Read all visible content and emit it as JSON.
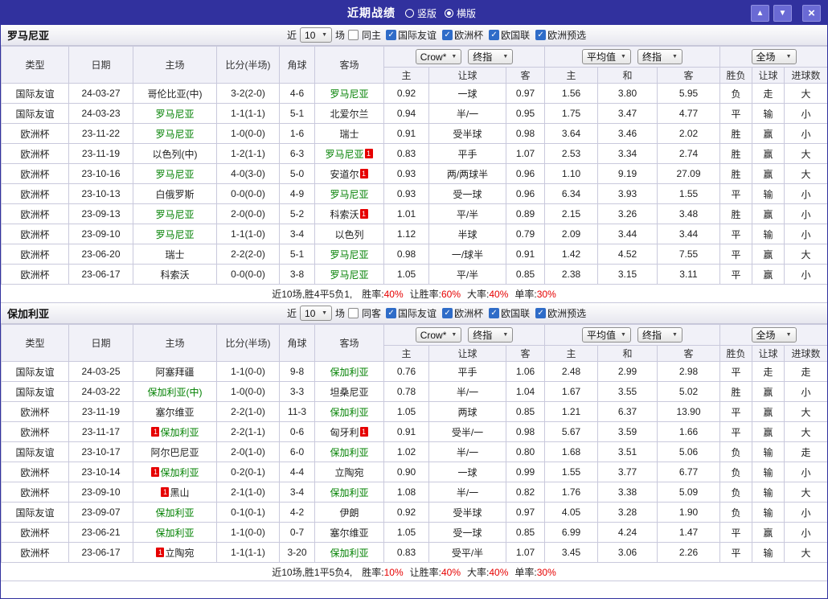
{
  "colors": {
    "titlebar_bg": "#31319e",
    "friendly_badge_bg": "#2f6cc8",
    "euro_badge_bg": "#8b1423",
    "team_highlight": "#008000",
    "win_red": "#e60000",
    "draw_green": "#008000",
    "loss_blue": "#1414cc",
    "score_red": "#a40000"
  },
  "titlebar": {
    "title": "近期战绩",
    "radio_vertical": "竖版",
    "radio_horizontal": "横版"
  },
  "filters": {
    "near_label": "近",
    "count": "10",
    "matches_label": "场",
    "leagues": [
      "国际友谊",
      "欧洲杯",
      "欧国联",
      "欧洲预选"
    ]
  },
  "table_header": {
    "cols": [
      "类型",
      "日期",
      "主场",
      "比分(半场)",
      "角球",
      "客场"
    ],
    "bookmaker": "Crow*",
    "asian_index": "终指",
    "euro_average": "平均值",
    "euro_index": "终指",
    "fulltime": "全场",
    "odds_cols": [
      "主",
      "让球",
      "客"
    ],
    "euro_cols": [
      "主",
      "和",
      "客"
    ],
    "result_cols": [
      "胜负",
      "让球",
      "进球数"
    ]
  },
  "sections": [
    {
      "team": "罗马尼亚",
      "same_label": "同主",
      "rows": [
        [
          "国际友谊",
          "24-03-27",
          "哥伦比亚(中)",
          "3-2(2-0)",
          "4-6",
          {
            "name": "罗马尼亚",
            "hl": true
          },
          "0.92",
          "一球",
          "0.97",
          "1.56",
          "3.80",
          "5.95",
          "负",
          "走",
          "大"
        ],
        [
          "国际友谊",
          "24-03-23",
          {
            "name": "罗马尼亚",
            "hl": true
          },
          "1-1(1-1)",
          "5-1",
          "北爱尔兰",
          "0.94",
          "半/一",
          "0.95",
          "1.75",
          "3.47",
          "4.77",
          "平",
          "输",
          "小"
        ],
        [
          "欧洲杯",
          "23-11-22",
          {
            "name": "罗马尼亚",
            "hl": true
          },
          "1-0(0-0)",
          "1-6",
          "瑞士",
          "0.91",
          "受半球",
          "0.98",
          "3.64",
          "3.46",
          "2.02",
          "胜",
          "赢",
          "小"
        ],
        [
          "欧洲杯",
          "23-11-19",
          "以色列(中)",
          "1-2(1-1)",
          "6-3",
          {
            "name": "罗马尼亚",
            "hl": true,
            "rc": "after"
          },
          "0.83",
          "平手",
          "1.07",
          "2.53",
          "3.34",
          "2.74",
          "胜",
          "赢",
          "大"
        ],
        [
          "欧洲杯",
          "23-10-16",
          {
            "name": "罗马尼亚",
            "hl": true
          },
          "4-0(3-0)",
          "5-0",
          {
            "name": "安道尔",
            "rc": "after"
          },
          "0.93",
          "两/两球半",
          "0.96",
          "1.10",
          "9.19",
          "27.09",
          "胜",
          "赢",
          "大"
        ],
        [
          "欧洲杯",
          "23-10-13",
          "白俄罗斯",
          "0-0(0-0)",
          "4-9",
          {
            "name": "罗马尼亚",
            "hl": true
          },
          "0.93",
          "受一球",
          "0.96",
          "6.34",
          "3.93",
          "1.55",
          "平",
          "输",
          "小"
        ],
        [
          "欧洲杯",
          "23-09-13",
          {
            "name": "罗马尼亚",
            "hl": true
          },
          "2-0(0-0)",
          "5-2",
          {
            "name": "科索沃",
            "rc": "after"
          },
          "1.01",
          "平/半",
          "0.89",
          "2.15",
          "3.26",
          "3.48",
          "胜",
          "赢",
          "小"
        ],
        [
          "欧洲杯",
          "23-09-10",
          {
            "name": "罗马尼亚",
            "hl": true
          },
          "1-1(1-0)",
          "3-4",
          "以色列",
          "1.12",
          "半球",
          "0.79",
          "2.09",
          "3.44",
          "3.44",
          "平",
          "输",
          "小"
        ],
        [
          "欧洲杯",
          "23-06-20",
          "瑞士",
          "2-2(2-0)",
          "5-1",
          {
            "name": "罗马尼亚",
            "hl": true
          },
          "0.98",
          "一/球半",
          "0.91",
          "1.42",
          "4.52",
          "7.55",
          "平",
          "赢",
          "大"
        ],
        [
          "欧洲杯",
          "23-06-17",
          "科索沃",
          "0-0(0-0)",
          "3-8",
          {
            "name": "罗马尼亚",
            "hl": true
          },
          "1.05",
          "平/半",
          "0.85",
          "2.38",
          "3.15",
          "3.11",
          "平",
          "赢",
          "小"
        ]
      ],
      "summary": {
        "prefix": "近10场,胜4平5负1,",
        "stats": [
          {
            "label": "胜率:",
            "value": "40%"
          },
          {
            "label": "让胜率:",
            "value": "60%"
          },
          {
            "label": "大率:",
            "value": "40%"
          },
          {
            "label": "单率:",
            "value": "30%"
          }
        ]
      }
    },
    {
      "team": "保加利亚",
      "same_label": "同客",
      "rows": [
        [
          "国际友谊",
          "24-03-25",
          "阿塞拜疆",
          "1-1(0-0)",
          "9-8",
          {
            "name": "保加利亚",
            "hl": true
          },
          "0.76",
          "平手",
          "1.06",
          "2.48",
          "2.99",
          "2.98",
          "平",
          "走",
          "走"
        ],
        [
          "国际友谊",
          "24-03-22",
          {
            "name": "保加利亚(中)",
            "hl": true
          },
          "1-0(0-0)",
          "3-3",
          "坦桑尼亚",
          "0.78",
          "半/一",
          "1.04",
          "1.67",
          "3.55",
          "5.02",
          "胜",
          "赢",
          "小"
        ],
        [
          "欧洲杯",
          "23-11-19",
          "塞尔维亚",
          "2-2(1-0)",
          "11-3",
          {
            "name": "保加利亚",
            "hl": true
          },
          "1.05",
          "两球",
          "0.85",
          "1.21",
          "6.37",
          "13.90",
          "平",
          "赢",
          "大"
        ],
        [
          "欧洲杯",
          "23-11-17",
          {
            "name": "保加利亚",
            "hl": true,
            "rc": "before"
          },
          "2-2(1-1)",
          "0-6",
          {
            "name": "匈牙利",
            "rc": "after"
          },
          "0.91",
          "受半/一",
          "0.98",
          "5.67",
          "3.59",
          "1.66",
          "平",
          "赢",
          "大"
        ],
        [
          "国际友谊",
          "23-10-17",
          "阿尔巴尼亚",
          "2-0(1-0)",
          "6-0",
          {
            "name": "保加利亚",
            "hl": true
          },
          "1.02",
          "半/一",
          "0.80",
          "1.68",
          "3.51",
          "5.06",
          "负",
          "输",
          "走"
        ],
        [
          "欧洲杯",
          "23-10-14",
          {
            "name": "保加利亚",
            "hl": true,
            "rc": "before"
          },
          "0-2(0-1)",
          "4-4",
          "立陶宛",
          "0.90",
          "一球",
          "0.99",
          "1.55",
          "3.77",
          "6.77",
          "负",
          "输",
          "小"
        ],
        [
          "欧洲杯",
          "23-09-10",
          {
            "name": "黑山",
            "rc": "before"
          },
          "2-1(1-0)",
          "3-4",
          {
            "name": "保加利亚",
            "hl": true
          },
          "1.08",
          "半/一",
          "0.82",
          "1.76",
          "3.38",
          "5.09",
          "负",
          "输",
          "大"
        ],
        [
          "国际友谊",
          "23-09-07",
          {
            "name": "保加利亚",
            "hl": true
          },
          "0-1(0-1)",
          "4-2",
          "伊朗",
          "0.92",
          "受半球",
          "0.97",
          "4.05",
          "3.28",
          "1.90",
          "负",
          "输",
          "小"
        ],
        [
          "欧洲杯",
          "23-06-21",
          {
            "name": "保加利亚",
            "hl": true
          },
          "1-1(0-0)",
          "0-7",
          "塞尔维亚",
          "1.05",
          "受一球",
          "0.85",
          "6.99",
          "4.24",
          "1.47",
          "平",
          "赢",
          "小"
        ],
        [
          "欧洲杯",
          "23-06-17",
          {
            "name": "立陶宛",
            "rc": "before"
          },
          "1-1(1-1)",
          "3-20",
          {
            "name": "保加利亚",
            "hl": true
          },
          "0.83",
          "受平/半",
          "1.07",
          "3.45",
          "3.06",
          "2.26",
          "平",
          "输",
          "大"
        ]
      ],
      "summary": {
        "prefix": "近10场,胜1平5负4,",
        "stats": [
          {
            "label": "胜率:",
            "value": "10%"
          },
          {
            "label": "让胜率:",
            "value": "40%"
          },
          {
            "label": "大率:",
            "value": "40%"
          },
          {
            "label": "单率:",
            "value": "30%"
          }
        ]
      }
    }
  ]
}
